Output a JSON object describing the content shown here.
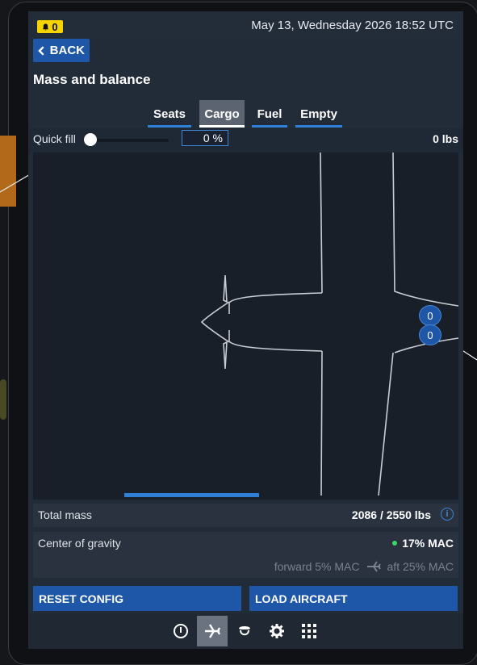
{
  "status_bar": {
    "notification_count": "0",
    "datetime": "May 13, Wednesday 2026 18:52 UTC"
  },
  "header": {
    "back_label": "BACK",
    "title": "Mass and balance"
  },
  "tabs": [
    {
      "label": "Seats",
      "active": false
    },
    {
      "label": "Cargo",
      "active": true
    },
    {
      "label": "Fuel",
      "active": false
    },
    {
      "label": "Empty",
      "active": false
    }
  ],
  "quick_fill": {
    "label": "Quick fill",
    "percent": "0 %",
    "level_fraction": 0,
    "weight": "0 lbs"
  },
  "cargo_markers": [
    "0",
    "0"
  ],
  "summary": {
    "total_mass_label": "Total mass",
    "total_mass_value": "2086 / 2550 lbs",
    "cg_label": "Center of gravity",
    "cg_value": "17% MAC",
    "cg_forward": "forward 5% MAC",
    "cg_aft": "aft 25% MAC"
  },
  "actions": {
    "reset": "RESET CONFIG",
    "load": "LOAD AIRCRAFT"
  },
  "bottom_nav": [
    {
      "icon": "compass-icon",
      "active": false
    },
    {
      "icon": "airplane-icon",
      "active": true
    },
    {
      "icon": "pilot-icon",
      "active": false
    },
    {
      "icon": "gear-icon",
      "active": false
    },
    {
      "icon": "apps-grid-icon",
      "active": false
    }
  ],
  "colors": {
    "accent": "#1f57a8",
    "badge": "#f5d400",
    "ok": "#3ed66a"
  }
}
